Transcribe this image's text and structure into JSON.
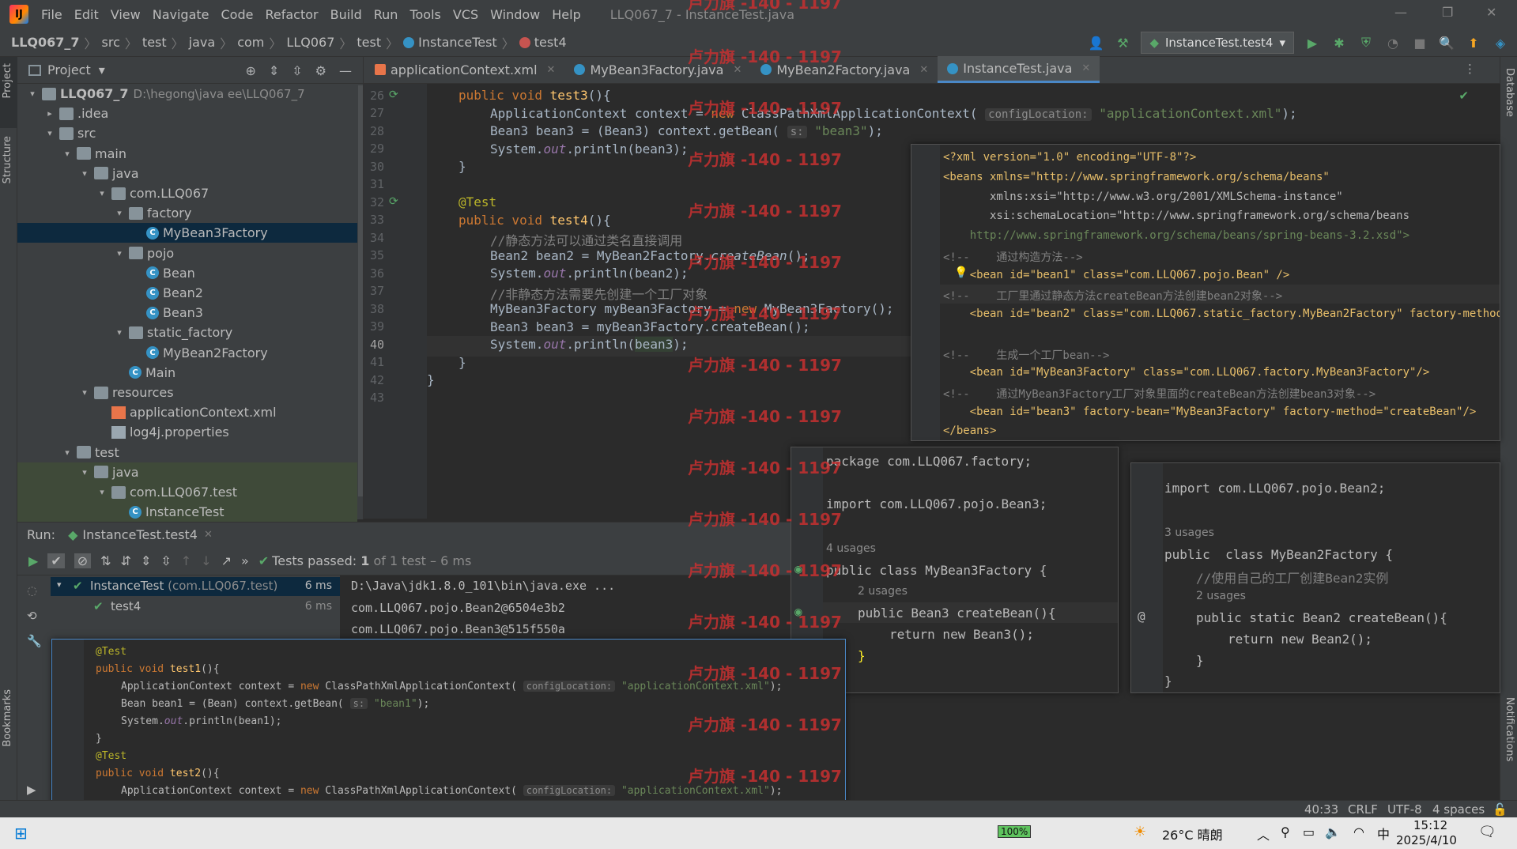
{
  "app": {
    "window_title": "LLQ067_7 - InstanceTest.java",
    "menu": [
      "File",
      "Edit",
      "View",
      "Navigate",
      "Code",
      "Refactor",
      "Build",
      "Run",
      "Tools",
      "VCS",
      "Window",
      "Help"
    ]
  },
  "breadcrumb": [
    "LLQ067_7",
    "src",
    "test",
    "java",
    "com",
    "LLQ067",
    "test",
    "InstanceTest",
    "test4"
  ],
  "run_config": "InstanceTest.test4",
  "left_tools": [
    "Project",
    "Structure",
    "Bookmarks"
  ],
  "right_tools": [
    "Database",
    "Notifications"
  ],
  "project": {
    "title": "Project",
    "tree": [
      {
        "label": "LLQ067_7",
        "hint": "D:\\hegong\\java ee\\LLQ067_7",
        "icon": "folder",
        "arrow": "▾",
        "indent": 0,
        "bold": true
      },
      {
        "label": ".idea",
        "icon": "folder",
        "arrow": "▸",
        "indent": 1
      },
      {
        "label": "src",
        "icon": "folder",
        "arrow": "▾",
        "indent": 1
      },
      {
        "label": "main",
        "icon": "folder",
        "arrow": "▾",
        "indent": 2
      },
      {
        "label": "java",
        "icon": "folder",
        "arrow": "▾",
        "indent": 3
      },
      {
        "label": "com.LLQ067",
        "icon": "folder",
        "arrow": "▾",
        "indent": 4
      },
      {
        "label": "factory",
        "icon": "folder",
        "arrow": "▾",
        "indent": 5
      },
      {
        "label": "MyBean3Factory",
        "icon": "class",
        "arrow": "",
        "indent": 6,
        "selected": true
      },
      {
        "label": "pojo",
        "icon": "folder",
        "arrow": "▾",
        "indent": 5
      },
      {
        "label": "Bean",
        "icon": "class",
        "arrow": "",
        "indent": 6
      },
      {
        "label": "Bean2",
        "icon": "class",
        "arrow": "",
        "indent": 6
      },
      {
        "label": "Bean3",
        "icon": "class",
        "arrow": "",
        "indent": 6
      },
      {
        "label": "static_factory",
        "icon": "folder",
        "arrow": "▾",
        "indent": 5
      },
      {
        "label": "MyBean2Factory",
        "icon": "class",
        "arrow": "",
        "indent": 6
      },
      {
        "label": "Main",
        "icon": "class",
        "arrow": "",
        "indent": 5
      },
      {
        "label": "resources",
        "icon": "folder",
        "arrow": "▾",
        "indent": 3
      },
      {
        "label": "applicationContext.xml",
        "icon": "xml",
        "arrow": "",
        "indent": 4
      },
      {
        "label": "log4j.properties",
        "icon": "props",
        "arrow": "",
        "indent": 4
      },
      {
        "label": "test",
        "icon": "folder",
        "arrow": "▾",
        "indent": 2
      },
      {
        "label": "java",
        "icon": "folder",
        "arrow": "▾",
        "indent": 3,
        "green": true
      },
      {
        "label": "com.LLQ067.test",
        "icon": "folder",
        "arrow": "▾",
        "indent": 4,
        "green": true
      },
      {
        "label": "InstanceTest",
        "icon": "class",
        "arrow": "",
        "indent": 5,
        "green": true
      }
    ]
  },
  "tabs": [
    {
      "label": "applicationContext.xml",
      "icon": "xml"
    },
    {
      "label": "MyBean3Factory.java",
      "icon": "class"
    },
    {
      "label": "MyBean2Factory.java",
      "icon": "class"
    },
    {
      "label": "InstanceTest.java",
      "icon": "class",
      "active": true
    }
  ],
  "editor": {
    "line_numbers": [
      "26",
      "27",
      "28",
      "29",
      "30",
      "31",
      "32",
      "33",
      "34",
      "35",
      "36",
      "37",
      "38",
      "39",
      "40",
      "41",
      "42",
      "43"
    ],
    "hints": {
      "configLocation": "configLocation:",
      "s": "s:"
    }
  },
  "xml_popup": {
    "lines": [
      "<?xml version=\"1.0\" encoding=\"UTF-8\"?>",
      "<beans xmlns=\"http://www.springframework.org/schema/beans\"",
      "       xmlns:xsi=\"http://www.w3.org/2001/XMLSchema-instance\"",
      "       xsi:schemaLocation=\"http://www.springframework.org/schema/beans",
      "    http://www.springframework.org/schema/beans/spring-beans-3.2.xsd\">",
      "<!--    通过构造方法-->",
      "    <bean id=\"bean1\" class=\"com.LLQ067.pojo.Bean\" />",
      "<!--    工厂里通过静态方法createBean方法创建bean2对象-->",
      "    <bean id=\"bean2\" class=\"com.LLQ067.static_factory.MyBean2Factory\" factory-method",
      "",
      "<!--    生成一个工厂bean-->",
      "    <bean id=\"MyBean3Factory\" class=\"com.LLQ067.factory.MyBean3Factory\"/>",
      "<!--    通过MyBean3Factory工厂对象里面的createBean方法创建bean3对象-->",
      "    <bean id=\"bean3\" factory-bean=\"MyBean3Factory\" factory-method=\"createBean\"/>",
      "</beans>"
    ]
  },
  "factory3_popup": {
    "package": "package com.LLQ067.factory;",
    "import": "import com.LLQ067.pojo.Bean3;",
    "usages_class": "4 usages",
    "class_decl": "public class MyBean3Factory {",
    "usages_method": "2 usages",
    "method": "public Bean3 createBean(){",
    "ret": "return new Bean3();",
    "close": "}"
  },
  "factory2_popup": {
    "import": "import com.LLQ067.pojo.Bean2;",
    "usages_class": "3 usages",
    "class_decl": "public  class MyBean2Factory {",
    "comment": "//使用自己的工厂创建Bean2实例",
    "usages_method": "2 usages",
    "method": "public static Bean2 createBean(){",
    "ret": "return new Bean2();",
    "close_inner": "}",
    "close": "}"
  },
  "run": {
    "label": "Run:",
    "tab": "InstanceTest.test4",
    "status_prefix": "Tests passed:",
    "status_count": "1",
    "status_suffix": "of 1 test – 6 ms",
    "tree": [
      {
        "label": "InstanceTest",
        "hint": "(com.LLQ067.test)",
        "time": "6 ms"
      },
      {
        "label": "test4",
        "hint": "",
        "time": "6 ms"
      }
    ],
    "console": [
      "D:\\Java\\jdk1.8.0_101\\bin\\java.exe ...",
      "com.LLQ067.pojo.Bean2@6504e3b2",
      "com.LLQ067.pojo.Bean3@515f550a"
    ]
  },
  "status_bar": {
    "position": "40:33",
    "line_sep": "CRLF",
    "encoding": "UTF-8",
    "indent": "4 spaces"
  },
  "taskbar": {
    "battery": "100%",
    "weather": "26°C 晴朗",
    "ime": "中",
    "time": "15:12",
    "date": "2025/4/10"
  },
  "watermark": "卢力旗 -140 - 1197",
  "colors": {
    "keyword": "#cc7832",
    "string": "#6a8759",
    "annotation": "#bbb529",
    "comment": "#808080",
    "selection": "#0d293e",
    "accent": "#4a88c7",
    "pass_green": "#59a869"
  }
}
